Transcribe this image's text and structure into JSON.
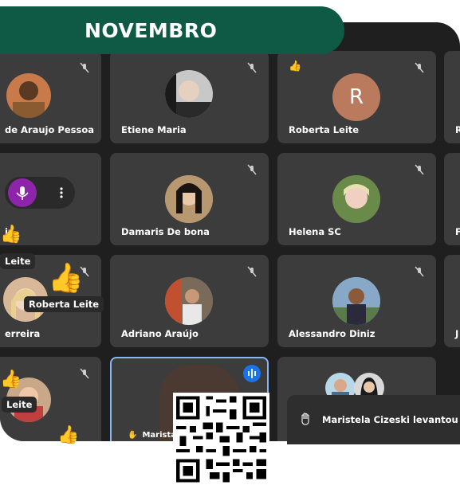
{
  "banner": {
    "title": "NOVEMBRO"
  },
  "participants": [
    {
      "name": "de Araujo Pessoa",
      "avatar": "photo"
    },
    {
      "name": "Etiene Maria",
      "avatar": "photo"
    },
    {
      "name": "Roberta Leite",
      "avatar": "R"
    },
    {
      "name": "R",
      "avatar": "none"
    },
    {
      "name": "iz",
      "avatar": "none"
    },
    {
      "name": "Damaris De bona",
      "avatar": "photo"
    },
    {
      "name": "Helena SC",
      "avatar": "photo"
    },
    {
      "name": "F",
      "avatar": "none"
    },
    {
      "name": "erreira",
      "avatar": "photo"
    },
    {
      "name": "Adriano Araújo",
      "avatar": "photo"
    },
    {
      "name": "Alessandro Diniz",
      "avatar": "photo"
    },
    {
      "name": "J",
      "avatar": "none"
    },
    {
      "name": "Marista",
      "avatar": "photo"
    }
  ],
  "reaction_chips": {
    "chip1": "Leite",
    "chip2": "Roberta Leite",
    "chip3": "Leite"
  },
  "notification": {
    "text": "Maristela Cizeski levantou a"
  },
  "colors": {
    "banner": "#0f5a44",
    "tile": "#3c3c3c",
    "speaking_border": "#8ab4f8",
    "raised_hand_avatar": "#8e24aa"
  }
}
